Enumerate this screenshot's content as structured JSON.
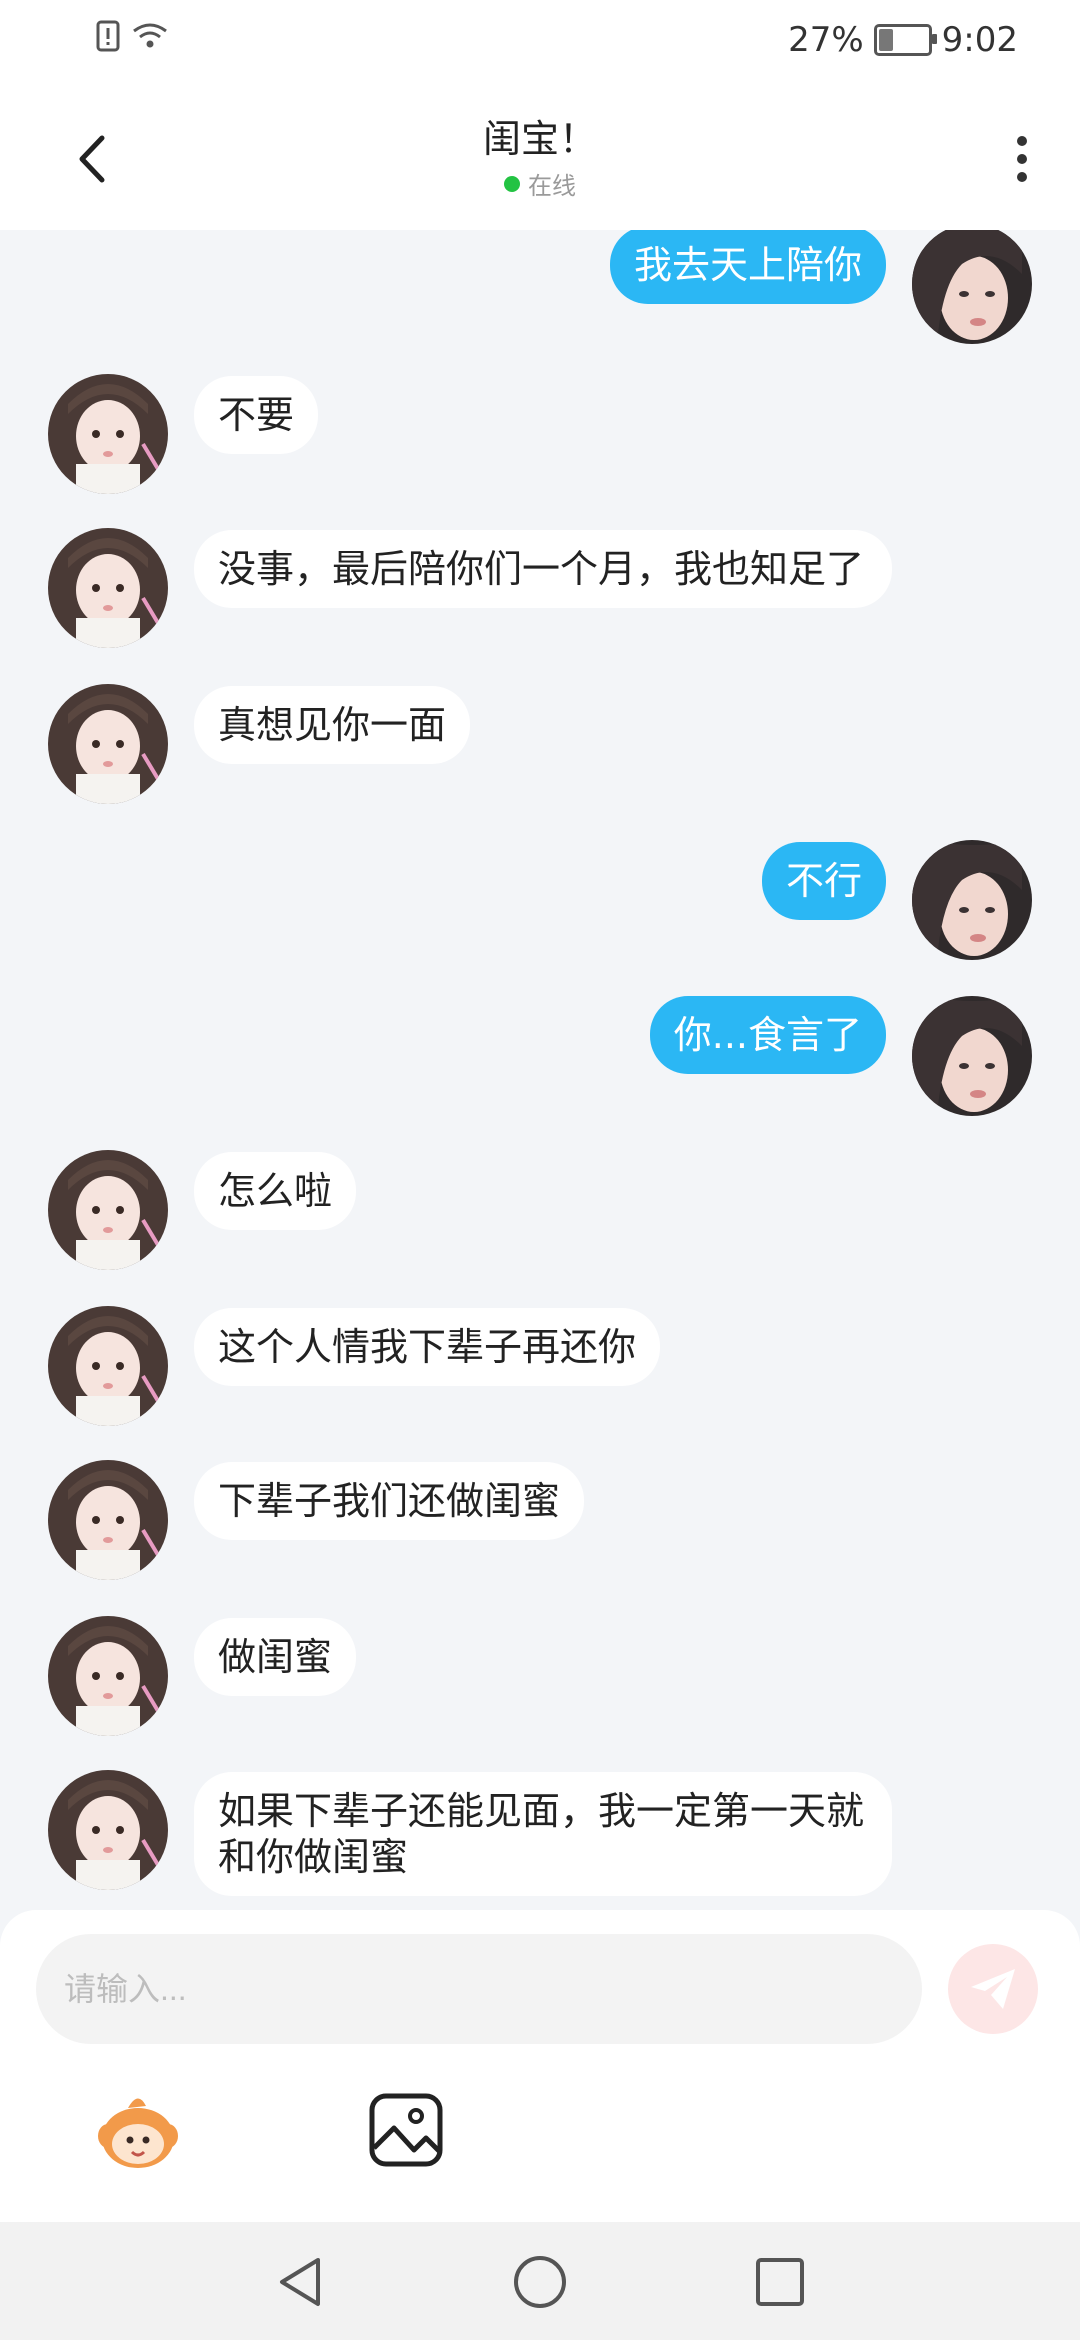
{
  "status_bar": {
    "battery": "27%",
    "time": "9:02"
  },
  "header": {
    "title": "闺宝！",
    "status": "在线"
  },
  "messages": [
    {
      "text": "我去天上陪你",
      "from": "me"
    },
    {
      "text": "不要",
      "from": "other"
    },
    {
      "text": "没事，最后陪你们一个月，我也知足了",
      "from": "other"
    },
    {
      "text": "真想见你一面",
      "from": "other"
    },
    {
      "text": "不行",
      "from": "me"
    },
    {
      "text": "你...食言了",
      "from": "me"
    },
    {
      "text": "怎么啦",
      "from": "other"
    },
    {
      "text": "这个人情我下辈子再还你",
      "from": "other"
    },
    {
      "text": "下辈子我们还做闺蜜",
      "from": "other"
    },
    {
      "text": "做闺蜜",
      "from": "other"
    },
    {
      "text": "如果下辈子还能见面，我一定第一天就和你做闺蜜",
      "from": "other"
    }
  ],
  "composer": {
    "placeholder": "请输入..."
  },
  "colors": {
    "my_bubble": "#2bb7f4",
    "other_bubble": "#ffffff",
    "online_dot": "#23c343",
    "send_button": "#fde6e6"
  },
  "icons": [
    "back-icon",
    "more-icon",
    "send-icon",
    "emoji-icon",
    "image-icon",
    "nav-back-icon",
    "nav-home-icon",
    "nav-recents-icon"
  ]
}
